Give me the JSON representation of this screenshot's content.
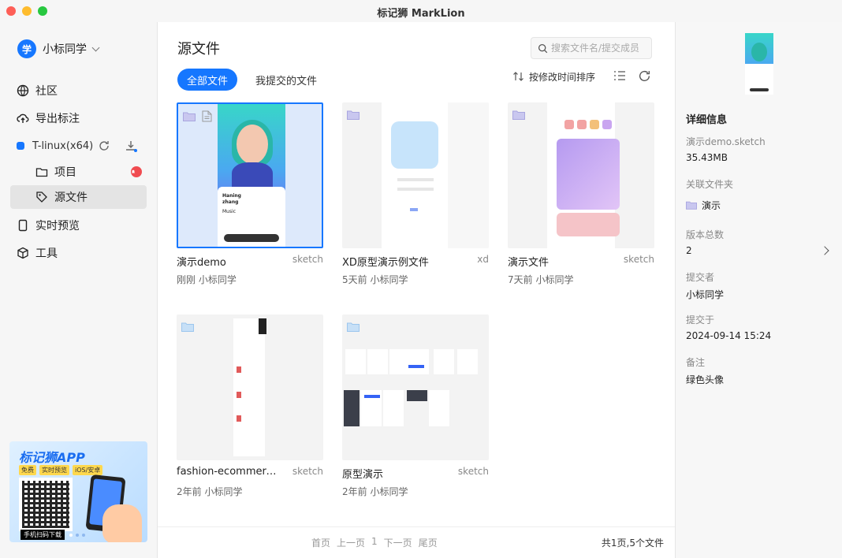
{
  "window": {
    "title": "标记狮 MarkLion"
  },
  "sidebar": {
    "user": {
      "avatar_text": "学",
      "name": "小标同学"
    },
    "nav": [
      {
        "label": "社区",
        "icon": "community-icon"
      },
      {
        "label": "导出标注",
        "icon": "cloud-upload-icon"
      }
    ],
    "project": {
      "label": "T-linux(x64)",
      "children": [
        {
          "label": "项目",
          "icon": "folder-icon"
        },
        {
          "label": "源文件",
          "icon": "tag-icon"
        }
      ]
    },
    "nav_bottom": [
      {
        "label": "实时预览",
        "icon": "phone-icon"
      },
      {
        "label": "工具",
        "icon": "cube-icon"
      }
    ],
    "promo": {
      "title": "标记狮APP",
      "tags": [
        "免费",
        "实时预览",
        "iOS/安卓"
      ],
      "caption": "手机扫码下载"
    }
  },
  "main": {
    "title": "源文件",
    "search": {
      "placeholder": "搜索文件名/提交成员"
    },
    "tabs": {
      "all": "全部文件",
      "mine": "我提交的文件"
    },
    "sort_label": "按修改时间排序",
    "files": [
      {
        "name": "演示demo",
        "type": "sketch",
        "meta": "刚刚 小标同学"
      },
      {
        "name": "XD原型演示例文件",
        "type": "xd",
        "meta": "5天前 小标同学"
      },
      {
        "name": "演示文件",
        "type": "sketch",
        "meta": "7天前 小标同学"
      },
      {
        "name": "fashion-ecommerce-u...",
        "type": "sketch",
        "meta": "2年前 小标同学"
      },
      {
        "name": "原型演示",
        "type": "sketch",
        "meta": "2年前 小标同学"
      }
    ],
    "preview": {
      "name_line1": "Haning",
      "name_line2": "zhang",
      "subtitle": "Music"
    },
    "pager": {
      "first": "首页",
      "prev": "上一页",
      "current": "1",
      "next": "下一页",
      "last": "尾页"
    },
    "total": "共1页,5个文件"
  },
  "detail": {
    "heading": "详细信息",
    "filename": "演示demo.sketch",
    "size": "35.43MB",
    "folder_label": "关联文件夹",
    "folder_value": "演示",
    "versions_label": "版本总数",
    "versions_value": "2",
    "submitter_label": "提交者",
    "submitter_value": "小标同学",
    "submitted_label": "提交于",
    "submitted_value": "2024-09-14 15:24",
    "note_label": "备注",
    "note_value": "绿色头像"
  },
  "colors": {
    "accent": "#1677ff",
    "badge": "#f04b50"
  }
}
